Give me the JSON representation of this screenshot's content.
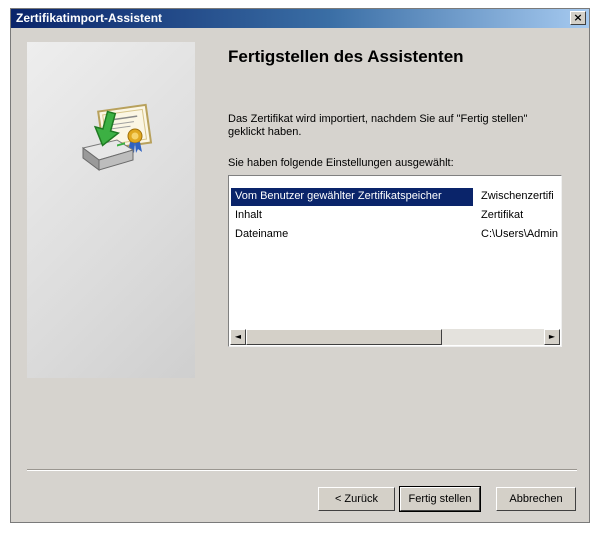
{
  "window": {
    "title": "Zertifikatimport-Assistent",
    "close_label": "×"
  },
  "main": {
    "heading": "Fertigstellen des Assistenten",
    "description": "Das Zertifikat wird importiert, nachdem Sie auf \"Fertig stellen\" geklickt haben.",
    "settings_label": "Sie haben folgende Einstellungen ausgewählt:",
    "settings": [
      {
        "name": "Vom Benutzer gewählter Zertifikatspeicher",
        "value": "Zwischenzertifi",
        "selected": true
      },
      {
        "name": "Inhalt",
        "value": "Zertifikat",
        "selected": false
      },
      {
        "name": "Dateiname",
        "value": "C:\\Users\\Admin",
        "selected": false
      }
    ]
  },
  "scrollbar": {
    "left_arrow": "◄",
    "right_arrow": "►"
  },
  "buttons": {
    "back": "< Zurück",
    "finish": "Fertig stellen",
    "cancel": "Abbrechen"
  },
  "colors": {
    "titlebar_start": "#0a246a",
    "selection": "#0a246a",
    "dialog_bg": "#d6d3ce"
  },
  "icons": {
    "wizard": "certificate-install-icon"
  }
}
